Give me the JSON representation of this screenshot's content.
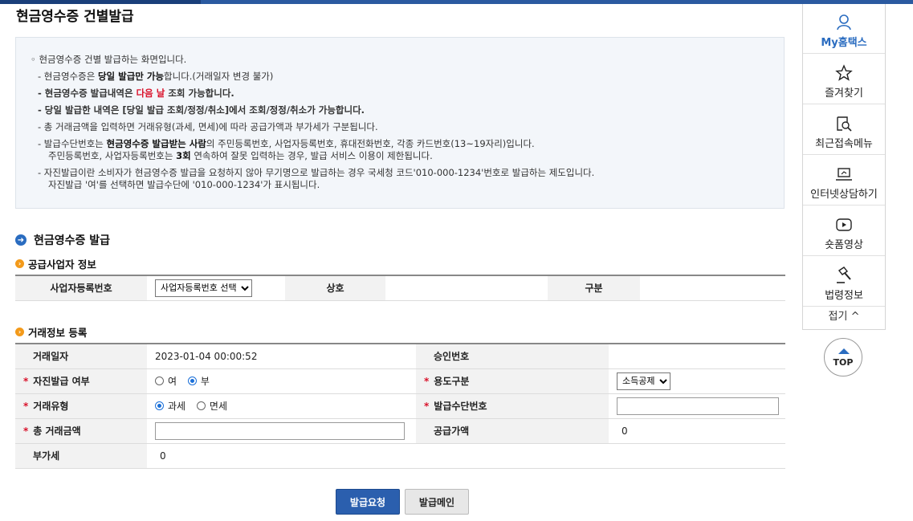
{
  "page": {
    "title": "현금영수증 건별발급"
  },
  "info": {
    "line1": "◦ 현금영수증 건별 발급하는 화면입니다.",
    "line2_a": "- 현금영수증은 ",
    "line2_b": "당일 발급만 가능",
    "line2_c": "합니다.(거래일자 변경 불가)",
    "line3_a": "- 현금영수증 발급내역은 ",
    "line3_b": "다음 날",
    "line3_c": " 조회 가능합니다.",
    "line4": "- 당일 발급한 내역은 [당일 발급 조회/정정/취소]에서 조회/정정/취소가 가능합니다.",
    "line5": "- 총 거래금액을 입력하면 거래유형(과세, 면세)에 따라 공급가액과 부가세가 구분됩니다.",
    "line6_a": "- 발급수단번호는 ",
    "line6_b": "현금영수증 발급받는 사람",
    "line6_c": "의  주민등록번호, 사업자등록번호, 휴대전화번호, 각종 카드번호(13~19자리)입니다.",
    "line7_a": "주민등록번호, 사업자등록번호는 ",
    "line7_b": "3회",
    "line7_c": " 연속하여 잘못 입력하는 경우, 발급 서비스 이용이 제한됩니다.",
    "line8": "- 자진발급이란 소비자가 현금영수증 발급을 요청하지 않아 무기명으로 발급하는 경우 국세청 코드'010-000-1234'번호로 발급하는 제도입니다.",
    "line9": "자진발급 '여'를 선택하면 발급수단에 '010-000-1234'가 표시됩니다."
  },
  "section": {
    "title": "현금영수증 발급"
  },
  "supplier": {
    "subtitle": "공급사업자 정보",
    "brn_label": "사업자등록번호",
    "brn_select": "사업자등록번호 선택",
    "name_label": "상호",
    "type_label": "구분"
  },
  "trade": {
    "subtitle": "거래정보 등록",
    "date_label": "거래일자",
    "date_value": "2023-01-04 00:00:52",
    "approval_label": "승인번호",
    "self_issue_label": "자진발급 여부",
    "self_yes": "여",
    "self_no": "부",
    "usage_label": "용도구분",
    "usage_value": "소득공제",
    "type_label": "거래유형",
    "type_taxable": "과세",
    "type_exempt": "면세",
    "means_label": "발급수단번호",
    "total_label": "총 거래금액",
    "supply_label": "공급가액",
    "supply_value": "0",
    "vat_label": "부가세",
    "vat_value": "0",
    "required_mark": "*"
  },
  "buttons": {
    "request": "발급요청",
    "main": "발급메인"
  },
  "sidebar": {
    "items": [
      {
        "label": "My홈택스",
        "icon": "user-icon"
      },
      {
        "label": "즐겨찾기",
        "icon": "star-icon"
      },
      {
        "label": "최근접속메뉴",
        "icon": "recent-search-icon"
      },
      {
        "label": "인터넷상담하기",
        "icon": "laptop-icon"
      },
      {
        "label": "숏폼영상",
        "icon": "play-icon"
      },
      {
        "label": "법령정보",
        "icon": "gavel-icon"
      }
    ],
    "fold": "접기 ^"
  },
  "top_button": {
    "label": "TOP"
  }
}
